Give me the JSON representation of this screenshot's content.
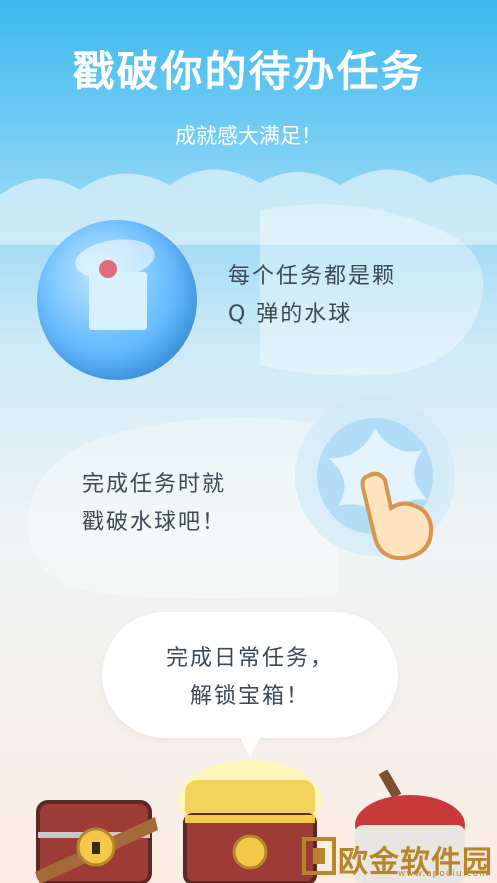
{
  "header": {
    "title": "戳破你的待办任务",
    "subtitle": "成就感大满足！"
  },
  "feature1": {
    "line1": "每个任务都是颗",
    "line2": "Q 弹的水球"
  },
  "feature2": {
    "line1": "完成任务时就",
    "line2": "戳破水球吧！"
  },
  "feature3": {
    "line1": "完成日常任务，",
    "line2": "解锁宝箱！"
  },
  "watermark": {
    "text": "欧金软件园",
    "sub": "www.apouiu.com"
  },
  "colors": {
    "sky_top": "#3bb8ee",
    "bubble": "#6fc0ff",
    "text": "#3b4a56",
    "chest_red": "#a83a3a",
    "gold": "#f2c94c"
  },
  "icons": [
    "sticky-note-icon",
    "pin-icon",
    "finger-tap-icon",
    "treasure-chest-icon",
    "lock-icon"
  ]
}
